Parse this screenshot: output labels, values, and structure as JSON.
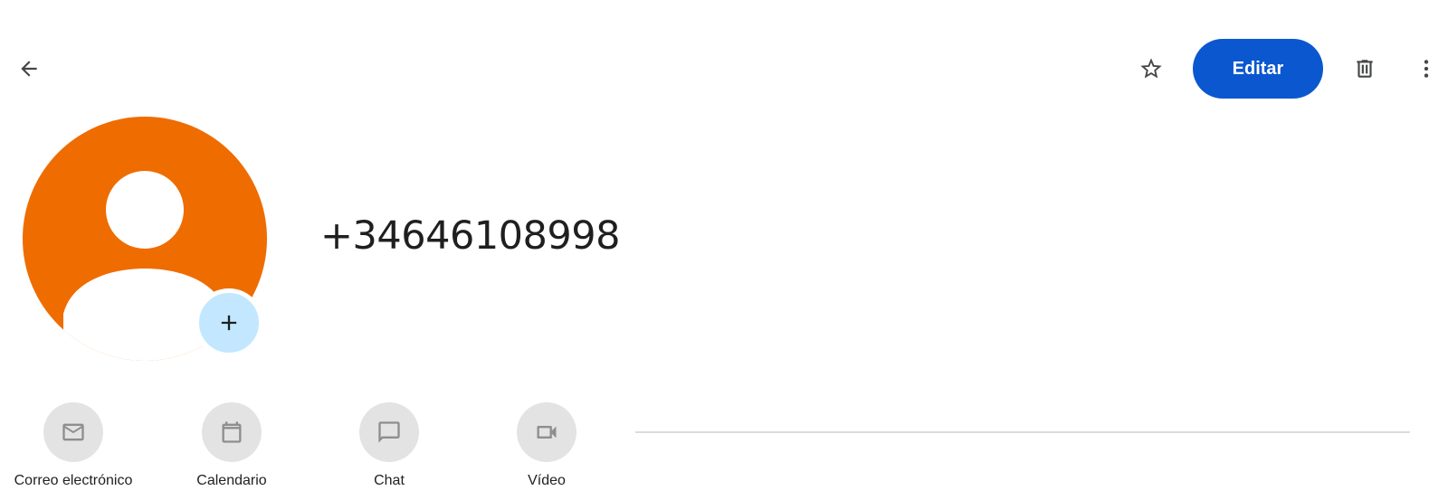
{
  "header": {
    "back_icon": "arrow-left-icon",
    "star_icon": "star-outline-icon",
    "edit_label": "Editar",
    "delete_icon": "trash-icon",
    "more_icon": "more-vertical-icon"
  },
  "contact": {
    "name": "+34646108998",
    "avatar_color": "#ef6c00",
    "add_photo_icon": "plus-icon"
  },
  "actions": [
    {
      "label": "Correo electrónico",
      "icon": "mail-icon"
    },
    {
      "label": "Calendario",
      "icon": "calendar-icon"
    },
    {
      "label": "Chat",
      "icon": "chat-icon"
    },
    {
      "label": "Vídeo",
      "icon": "video-icon"
    }
  ],
  "colors": {
    "primary": "#0b57d0",
    "avatar": "#ef6c00",
    "add_photo_bg": "#c2e7ff",
    "action_bg": "#e3e3e3",
    "divider": "#dadce0"
  }
}
